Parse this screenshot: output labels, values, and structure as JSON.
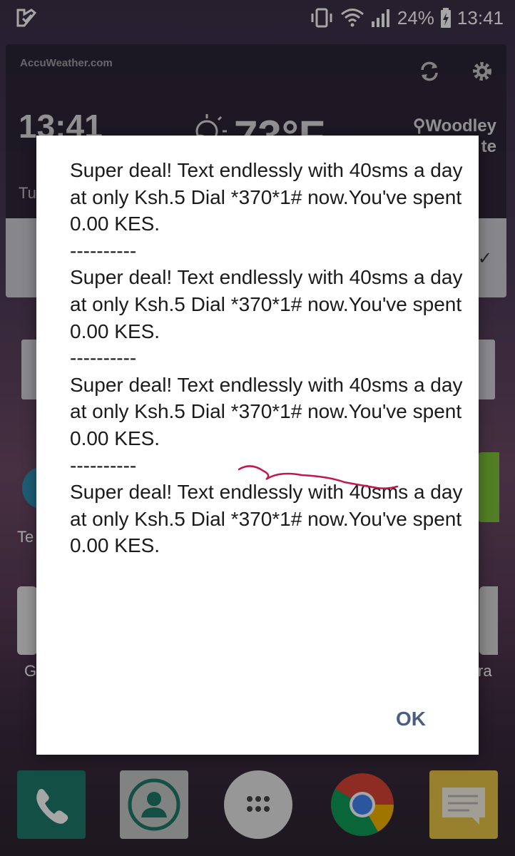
{
  "status_bar": {
    "battery_percent": "24%",
    "time": "13:41"
  },
  "weather_widget": {
    "brand": "AccuWeather.com",
    "time": "13:41",
    "day_fragment": "Tu",
    "temperature_fragment": "73°F",
    "location": "Woodley",
    "location_fragment": "te"
  },
  "home_labels": {
    "left_app_fragment": "Te",
    "gmail_fragment": "G",
    "camera_fragment": "ra"
  },
  "dialog": {
    "messages": [
      {
        "text": "Super deal! Text endlessly with 40sms a day at only Ksh.5 Dial *370*1# now.You've spent  0.00 KES.",
        "separator": "----------"
      },
      {
        "text": "Super deal! Text endlessly with 40sms a day at only Ksh.5 Dial *370*1# now.You've spent  0.00 KES.",
        "separator": "----------"
      },
      {
        "text": "Super deal! Text endlessly with 40sms a day at only Ksh.5 Dial *370*1# now.You've spent  0.00 KES.",
        "separator": "----------"
      },
      {
        "text": "Super deal! Text endlessly with 40sms a day at only Ksh.5 Dial *370*1# now.You've spent  0.00 KES."
      }
    ],
    "ok_label": "OK"
  },
  "colors": {
    "ok_text": "#4a5e82",
    "annotation_stroke": "#c0184c",
    "dialog_bg": "#ffffff"
  }
}
